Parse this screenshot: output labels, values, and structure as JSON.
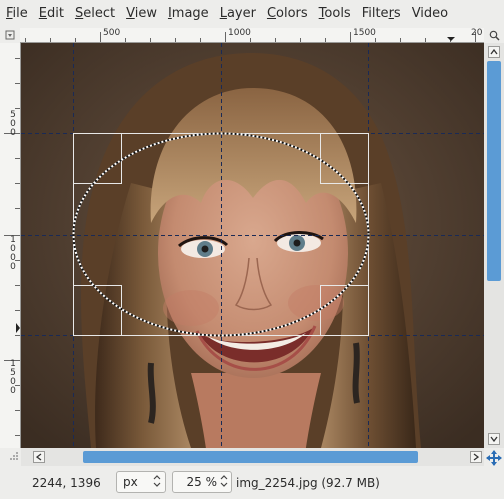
{
  "menubar": {
    "items": [
      {
        "mnemonic": "F",
        "rest": "ile"
      },
      {
        "mnemonic": "E",
        "rest": "dit"
      },
      {
        "mnemonic": "S",
        "rest": "elect"
      },
      {
        "mnemonic": "V",
        "rest": "iew"
      },
      {
        "mnemonic": "I",
        "rest": "mage"
      },
      {
        "mnemonic": "L",
        "rest": "ayer"
      },
      {
        "mnemonic": "C",
        "rest": "olors"
      },
      {
        "mnemonic": "T",
        "rest": "ools"
      },
      {
        "pre": "Filte",
        "mnemonic": "r",
        "rest": "s"
      },
      {
        "mnemonic": "",
        "rest": "Video"
      }
    ]
  },
  "top_ruler": {
    "labels": [
      "500",
      "1000",
      "1500",
      "20"
    ]
  },
  "left_ruler": {
    "labels": [
      [
        "5",
        "0",
        "0"
      ],
      [
        "1",
        "0",
        "0",
        "0"
      ],
      [
        "1",
        "5",
        "0",
        "0"
      ]
    ]
  },
  "canvas": {
    "image_alt": "Portrait photo of a smiling woman with blonde hair and bangs",
    "selection_shape": "ellipse",
    "guide_style": "dashed"
  },
  "statusbar": {
    "coords": "2244, 1396",
    "unit": "px",
    "zoom": "25 %",
    "file_info": "img_2254.jpg (92.7 MB)"
  },
  "colors": {
    "accent": "#5b9bd5",
    "background": "#ededeb"
  }
}
